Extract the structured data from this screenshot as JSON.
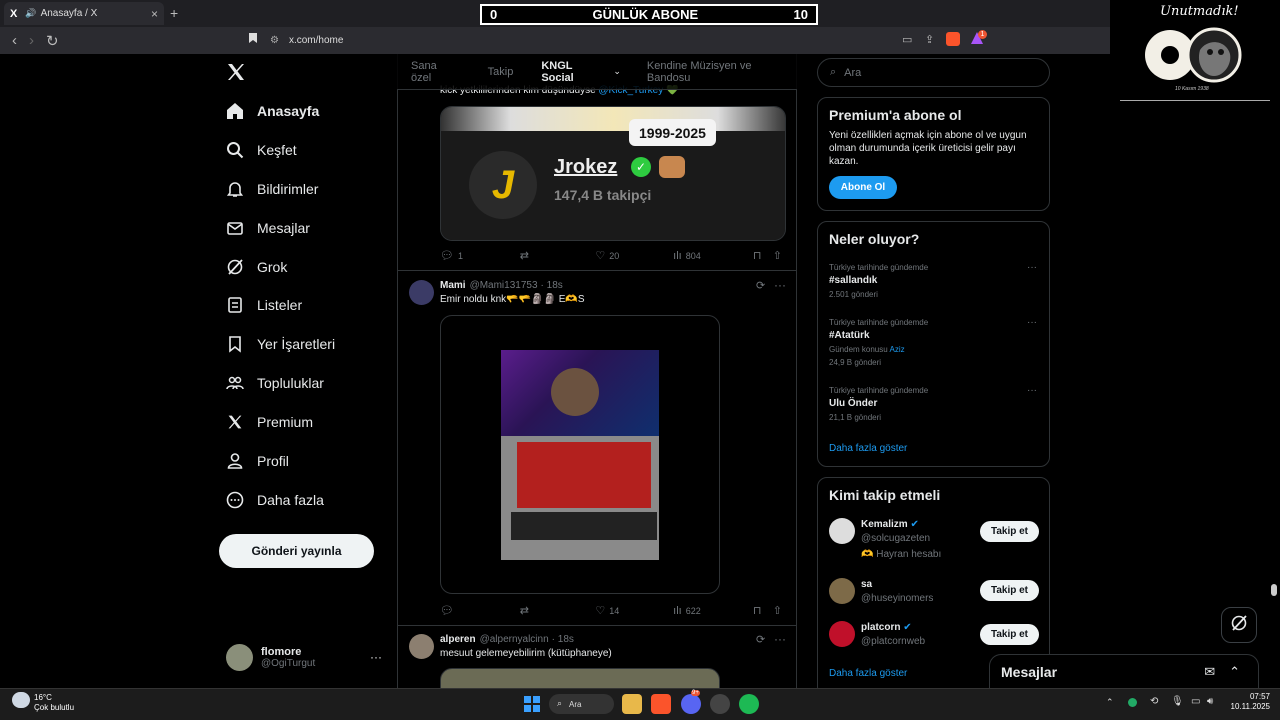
{
  "browser": {
    "tab_title": "Anasayfa / X",
    "tab_logo": "X",
    "new_tab": "+",
    "url": "x.com/home",
    "shield_badge": "1"
  },
  "overlay": {
    "counter_left": "0",
    "counter_title": "GÜNLÜK ABONE",
    "counter_right": "10",
    "signature": "Unutmadık!",
    "signature_date": "10 Kasım 1938"
  },
  "nav": {
    "logo": "X",
    "items": [
      {
        "label": "Anasayfa",
        "icon": "home-icon"
      },
      {
        "label": "Keşfet",
        "icon": "search-icon"
      },
      {
        "label": "Bildirimler",
        "icon": "bell-icon"
      },
      {
        "label": "Mesajlar",
        "icon": "mail-icon"
      },
      {
        "label": "Grok",
        "icon": "grok-icon"
      },
      {
        "label": "Listeler",
        "icon": "list-icon"
      },
      {
        "label": "Yer İşaretleri",
        "icon": "bookmark-icon"
      },
      {
        "label": "Topluluklar",
        "icon": "communities-icon"
      },
      {
        "label": "Premium",
        "icon": "x-icon"
      },
      {
        "label": "Profil",
        "icon": "person-icon"
      },
      {
        "label": "Daha fazla",
        "icon": "more-circle-icon"
      }
    ],
    "post_button": "Gönderi yayınla",
    "account": {
      "name": "flomore",
      "handle": "@OgiTurgut",
      "more": "···"
    }
  },
  "feed": {
    "tabs": [
      "Sana özel",
      "Takip",
      "KNGL Social",
      "Kendine Müzisyen ve Bandosu"
    ],
    "active_tab": "KNGL Social",
    "posts": [
      {
        "text_prefix": "kick yetkililerinden kim düşündüyse ",
        "mention": "@Kick_Turkey",
        "emoji": "💚",
        "card": {
          "badge": "1999-2025",
          "name": "Jrokez",
          "followers": "147,4 B takipçi",
          "logo": "J"
        },
        "replies": "1",
        "reposts": "",
        "likes": "20",
        "views": "804"
      },
      {
        "name": "Mami",
        "handle": "@Mami131753",
        "time": "· 18s",
        "text": "Emir noldu knk🫳🫳🗿🗿 E🫶S",
        "replies": "",
        "reposts": "",
        "likes": "14",
        "views": "622"
      },
      {
        "name": "alperen",
        "handle": "@alpernyalcinn",
        "time": "· 18s",
        "text": "mesuut gelemeyebilirim (kütüphaneye)"
      }
    ]
  },
  "right": {
    "search_placeholder": "Ara",
    "premium": {
      "title": "Premium'a abone ol",
      "body": "Yeni özellikleri açmak için abone ol ve uygun olman durumunda içerik üreticisi gelir payı kazan.",
      "button": "Abone Ol"
    },
    "trends": {
      "title": "Neler oluyor?",
      "items": [
        {
          "context": "Türkiye tarihinde gündemde",
          "name": "#sallandık",
          "extra": "",
          "extra_link": "",
          "count": "2.501 gönderi"
        },
        {
          "context": "Türkiye tarihinde gündemde",
          "name": "#Atatürk",
          "extra": "Gündem konusu ",
          "extra_link": "Aziz",
          "count": "24,9 B gönderi"
        },
        {
          "context": "Türkiye tarihinde gündemde",
          "name": "Ulu Önder",
          "extra": "",
          "extra_link": "",
          "count": "21,1 B gönderi"
        }
      ],
      "more": "Daha fazla göster",
      "dots": "···"
    },
    "who_to_follow": {
      "title": "Kimi takip etmeli",
      "users": [
        {
          "name": "Kemalizm",
          "handle": "@solcugazeten",
          "verified": true,
          "note": "🫶 Hayran hesabı"
        },
        {
          "name": "sa",
          "handle": "@huseyinomers",
          "verified": false,
          "note": ""
        },
        {
          "name": "platcorn",
          "handle": "@platcornweb",
          "verified": true,
          "note": ""
        }
      ],
      "follow_label": "Takip et",
      "more": "Daha fazla göster"
    }
  },
  "messages_drawer": {
    "title": "Mesajlar"
  },
  "taskbar": {
    "weather_temp": "16°C",
    "weather_desc": "Çok bulutlu",
    "search": "Ara",
    "time": "07:57",
    "date": "10.11.2025",
    "discord_badge": "9+"
  },
  "colors": {
    "accent": "#1d9bf0",
    "verified": "#1d9bf0",
    "background": "#000000",
    "border": "#2f3336",
    "muted": "#71767b"
  }
}
